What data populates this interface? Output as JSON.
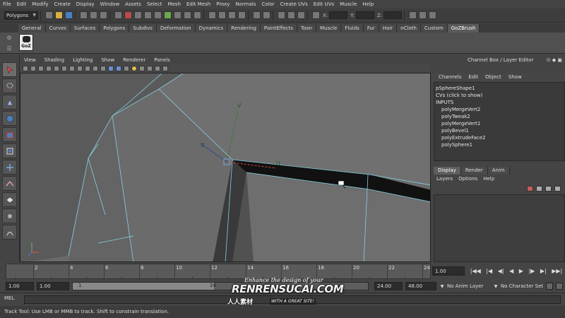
{
  "menubar": {
    "items": [
      "File",
      "Edit",
      "Modify",
      "Create",
      "Display",
      "Window",
      "Assets",
      "Select",
      "Mesh",
      "Edit Mesh",
      "Proxy",
      "Normals",
      "Color",
      "Create UVs",
      "Edit UVs",
      "Muscle",
      "Help"
    ]
  },
  "statusline": {
    "mode": "Polygons",
    "x_label": "X:",
    "y_label": "Y:",
    "z_label": "Z:"
  },
  "shelf": {
    "tabs": [
      "General",
      "Curves",
      "Surfaces",
      "Polygons",
      "Subdivs",
      "Deformation",
      "Dynamics",
      "Rendering",
      "PaintEffects",
      "Toon",
      "Muscle",
      "Fluids",
      "Fur",
      "Hair",
      "nCloth",
      "Custom",
      "GoZBrush"
    ],
    "active_tab": "GoZBrush",
    "goz_button": "GoZ"
  },
  "panel": {
    "menu": [
      "View",
      "Shading",
      "Lighting",
      "Show",
      "Renderer",
      "Panels"
    ]
  },
  "manipulator": {
    "v_label": "V",
    "u_label": "U",
    "n_label": "N"
  },
  "channelbox": {
    "title": "Channel Box / Layer Editor",
    "menu": [
      "Channels",
      "Edit",
      "Object",
      "Show"
    ],
    "shape_node": "pSphereShape1",
    "cvs_row": "CVs (click to show)",
    "inputs_header": "INPUTS",
    "inputs": [
      "polyMergeVert2",
      "polyTweak2",
      "polyMergeVert1",
      "polyBevel1",
      "polyExtrudeFace2",
      "polySphere1"
    ]
  },
  "layereditor": {
    "tabs": [
      "Display",
      "Render",
      "Anim"
    ],
    "active_tab": "Display",
    "menu": [
      "Layers",
      "Options",
      "Help"
    ]
  },
  "timeslider": {
    "ticks": [
      "2",
      "4",
      "6",
      "8",
      "10",
      "12",
      "14",
      "16",
      "18",
      "20",
      "22",
      "24"
    ],
    "current_frame": "1.00",
    "playback_buttons": [
      "go-to-start",
      "step-back",
      "step-back-key",
      "play-back",
      "play-forward",
      "step-forward-key",
      "step-forward",
      "go-to-end"
    ]
  },
  "range": {
    "start_time": "1.00",
    "playback_start": "1.00",
    "slider_start": "1",
    "slider_end": "24",
    "playback_end": "24.00",
    "end_time": "48.00",
    "anim_layer": "No Anim Layer",
    "character_set": "No Character Set"
  },
  "mel": {
    "label": "MEL"
  },
  "helpline": {
    "text": "Track Tool: Use LMB or MMB to track. Shift to constrain translation."
  },
  "watermark": {
    "line1": "Enhance the design of your",
    "line2": "RENRENSUCAI.COM",
    "line3": "人人素材",
    "line4": "WITH A GREAT SITE!"
  }
}
